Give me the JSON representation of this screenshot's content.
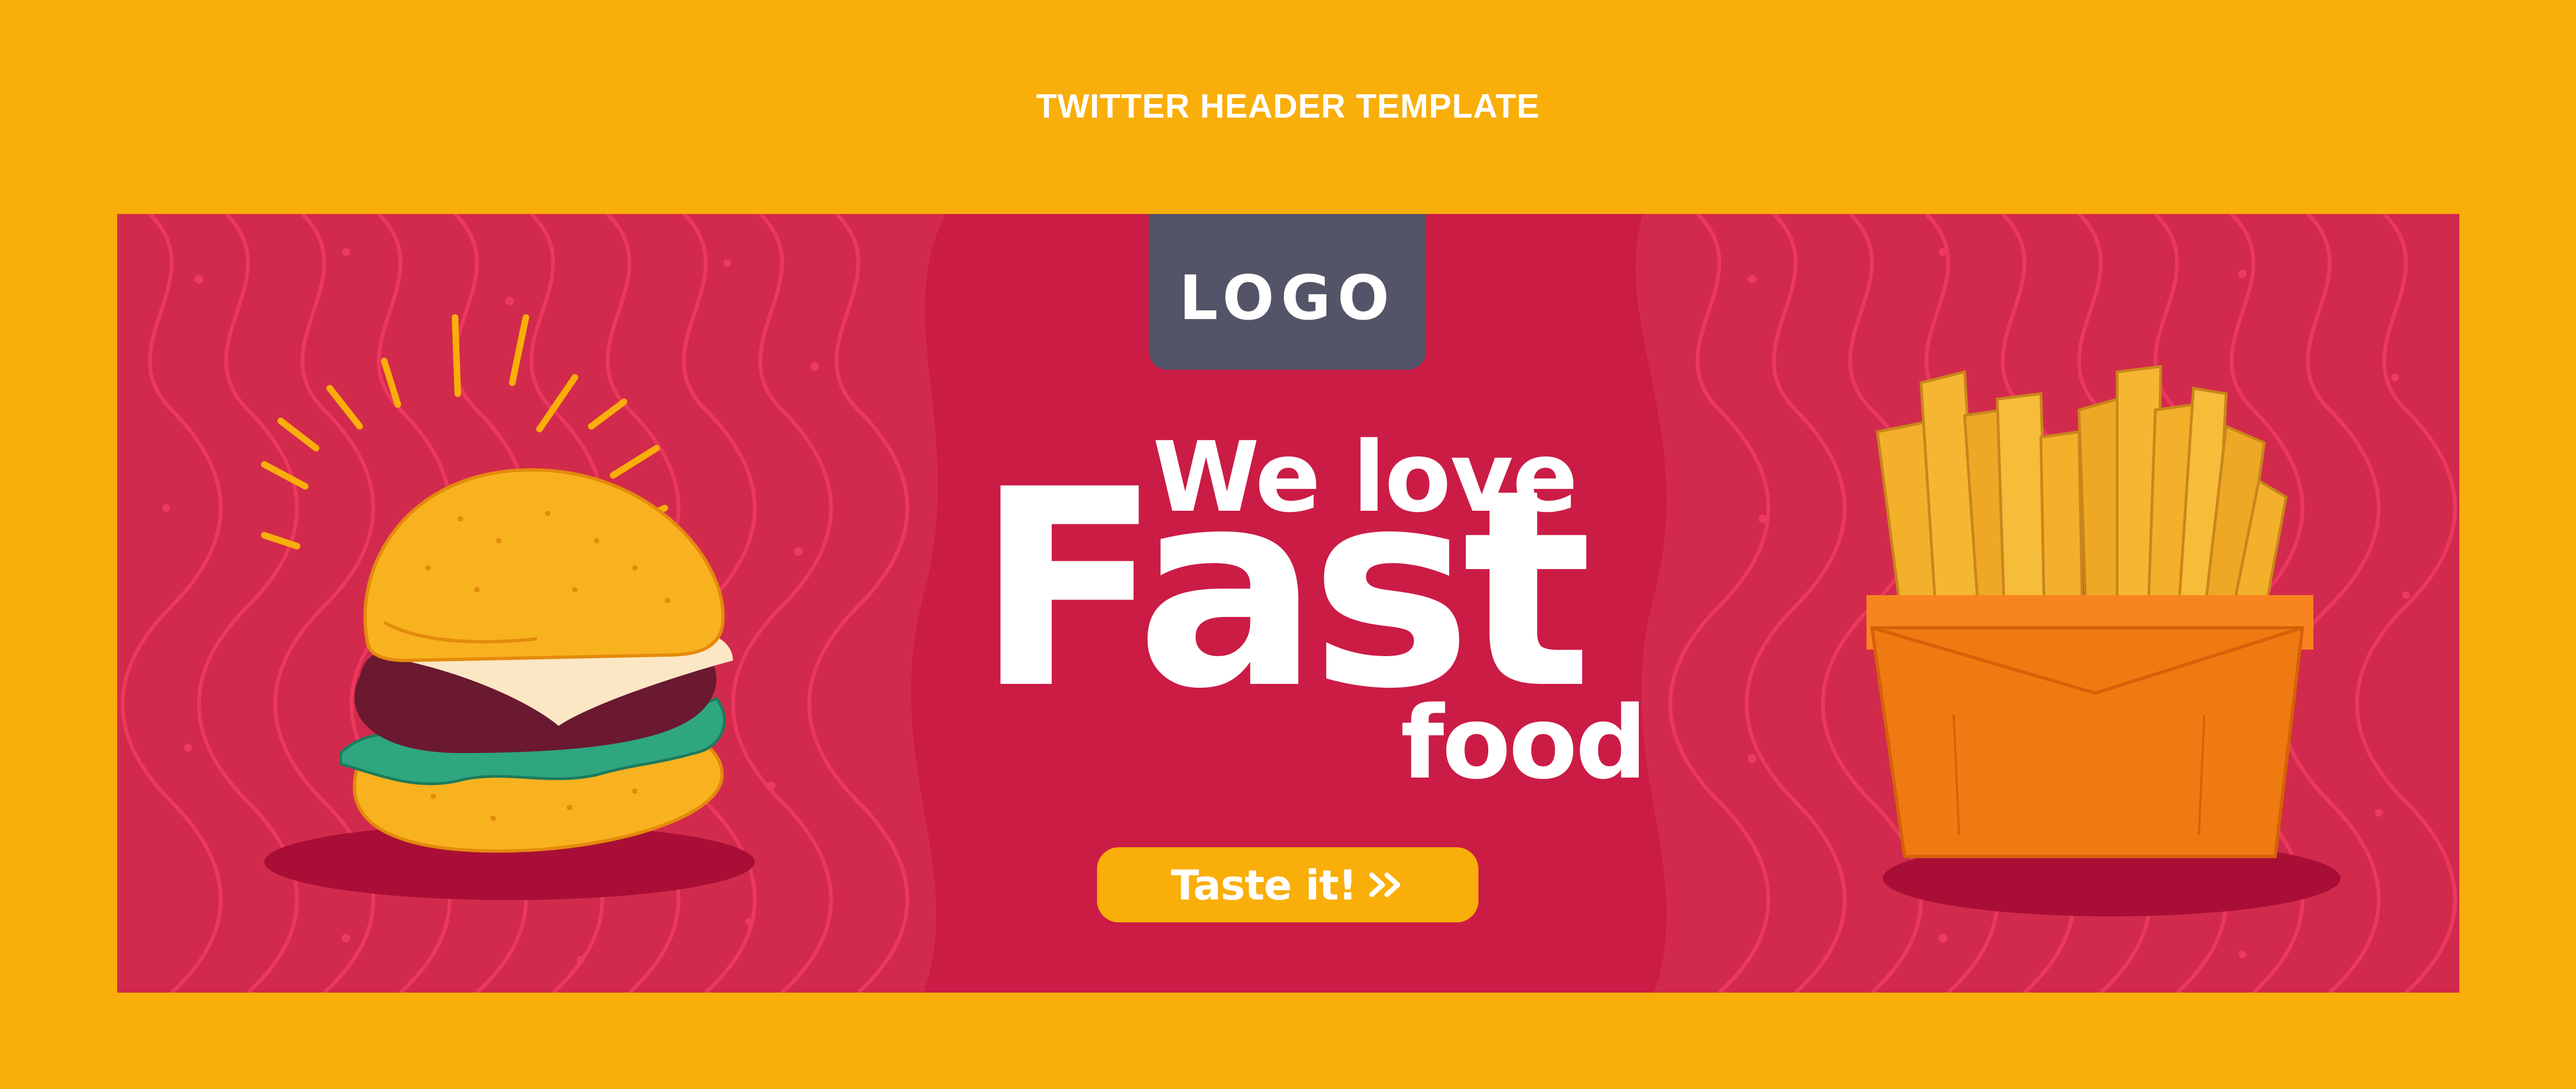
{
  "page": {
    "heading": "TWITTER HEADER TEMPLATE"
  },
  "banner": {
    "logo_label": "LOGO",
    "headline": {
      "line1": "We love",
      "line2": "Fast",
      "line3": "food"
    },
    "cta": {
      "label": "Taste it!",
      "icon": "double-chevron-right-icon"
    },
    "illustrations": [
      "burger-illustration",
      "fries-illustration"
    ]
  },
  "colors": {
    "page_background": "#F9AE0A",
    "banner_background": "#D22A4C",
    "banner_center_band": "#CB1C45",
    "wave_lines": "#EE3A60",
    "logo_box": "#545468",
    "text": "#FFFFFF",
    "cta_background": "#F9AE0A"
  }
}
